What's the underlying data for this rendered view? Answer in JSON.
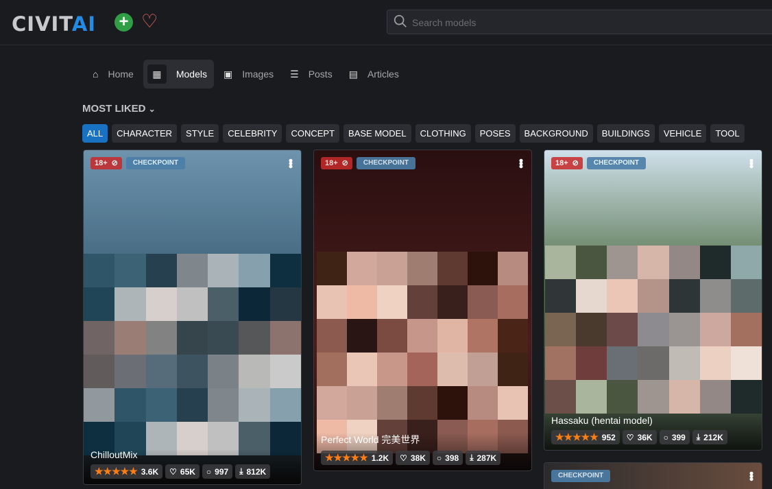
{
  "brand": {
    "logo_a": "CIVIT",
    "logo_b": "AI",
    "accent": "#228be6"
  },
  "search": {
    "placeholder": "Search models"
  },
  "nav": [
    {
      "label": "Home",
      "icon": "home-icon",
      "glyph": "⌂"
    },
    {
      "label": "Models",
      "icon": "grid-icon",
      "glyph": "▦"
    },
    {
      "label": "Images",
      "icon": "image-icon",
      "glyph": "▣"
    },
    {
      "label": "Posts",
      "icon": "posts-icon",
      "glyph": "☰"
    },
    {
      "label": "Articles",
      "icon": "article-icon",
      "glyph": "▤"
    }
  ],
  "sort": {
    "label": "MOST LIKED"
  },
  "categories": [
    "ALL",
    "CHARACTER",
    "STYLE",
    "CELEBRITY",
    "CONCEPT",
    "BASE MODEL",
    "CLOTHING",
    "POSES",
    "BACKGROUND",
    "BUILDINGS",
    "VEHICLE",
    "TOOL"
  ],
  "badges": {
    "nsfw": "18+",
    "type": "CHECKPOINT"
  },
  "cards": [
    {
      "name": "ChilloutMix",
      "rating": "3.6K",
      "likes": "65K",
      "comments": "997",
      "downloads": "812K"
    },
    {
      "name": "Perfect World 完美世界",
      "rating": "1.2K",
      "likes": "38K",
      "comments": "398",
      "downloads": "287K"
    },
    {
      "name": "Hassaku (hentai model)",
      "rating": "952",
      "likes": "36K",
      "comments": "399",
      "downloads": "212K"
    }
  ]
}
